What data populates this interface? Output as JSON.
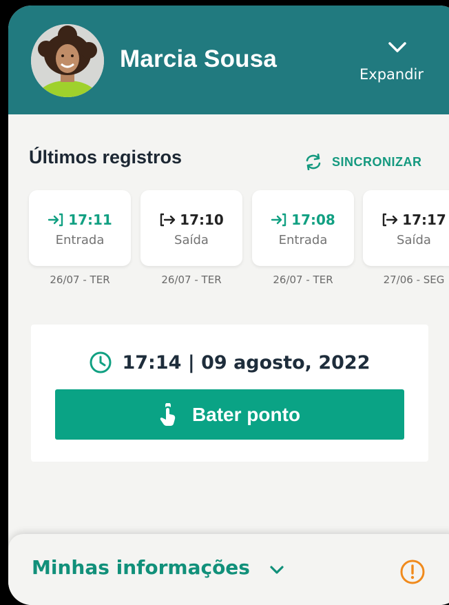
{
  "user": {
    "name": "Marcia Sousa"
  },
  "header": {
    "expand_label": "Expandir"
  },
  "records_section": {
    "title": "Últimos registros",
    "sync_label": "SINCRONIZAR",
    "records": [
      {
        "direction": "in",
        "icon": "login-arrow-icon",
        "time": "17:11",
        "type": "Entrada",
        "date": "26/07 - TER"
      },
      {
        "direction": "out",
        "icon": "logout-arrow-icon",
        "time": "17:10",
        "type": "Saída",
        "date": "26/07 - TER"
      },
      {
        "direction": "in",
        "icon": "login-arrow-icon",
        "time": "17:08",
        "type": "Entrada",
        "date": "26/07 - TER"
      },
      {
        "direction": "out",
        "icon": "logout-arrow-icon",
        "time": "17:17",
        "type": "Saída",
        "date": "27/06 - SEG"
      }
    ]
  },
  "clock": {
    "datetime": "17:14 | 09 agosto, 2022",
    "button_label": "Bater ponto"
  },
  "bottom": {
    "title": "Minhas informações"
  },
  "colors": {
    "header": "#217a7f",
    "accent": "#0aa385",
    "sync": "#14997f",
    "alert": "#f08a1c"
  }
}
